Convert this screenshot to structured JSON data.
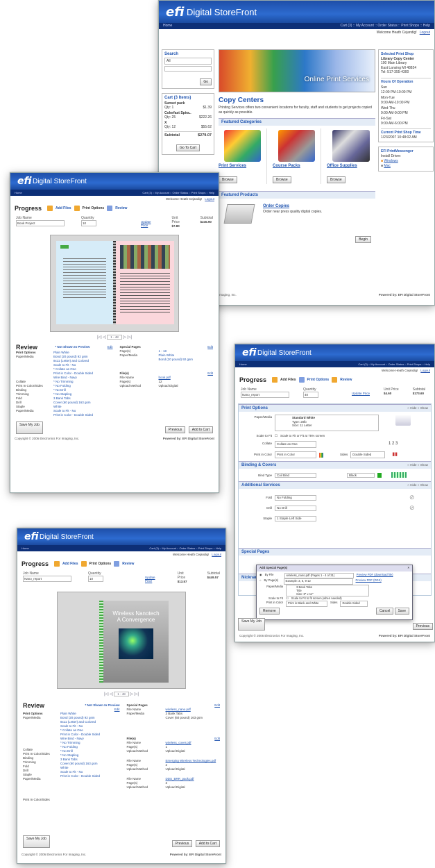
{
  "brand": {
    "logo": "efi",
    "name": "Digital StoreFront"
  },
  "nav": {
    "home": "Home",
    "links": "Cart (3) :: My Account :: Order Status :: Print Shops :: Help"
  },
  "welcome": {
    "text": "Welcome Heath Cejandig!",
    "logout": "Logout"
  },
  "store": {
    "search": {
      "title": "Search",
      "scope": "All",
      "go": "Go"
    },
    "cart": {
      "title": "Cart (3 Items)",
      "items": [
        {
          "name": "Sunset pack",
          "qty": "Qty: 1",
          "price": "$1.39"
        },
        {
          "name": "Colorfast Spira..",
          "qty": "Qty: 25",
          "price": "$222.26"
        },
        {
          "name": "X",
          "qty": "Qty: 12",
          "price": "$55.62"
        }
      ],
      "subtotal_label": "Subtotal",
      "subtotal": "$279.07",
      "go_to_cart": "Go To Cart"
    },
    "banner": "Online Print Services",
    "heading": "Copy Centers",
    "intro": "Printing Services offers two convenient locations for faculty, staff and students to get projects copied as quickly as possible.",
    "featured_categories": "Featured Categories",
    "categories": [
      {
        "name": "Print Services",
        "browse": "Browse"
      },
      {
        "name": "Course Packs",
        "browse": "Browse"
      },
      {
        "name": "Office Supplies",
        "browse": "Browse"
      }
    ],
    "featured_products": "Featured Products",
    "product": {
      "name": "Order Copies",
      "desc": "Order near press quality digital copies.",
      "begin": "Begin"
    },
    "shop": {
      "title": "Selected Print Shop",
      "name": "Library Copy Center",
      "addr1": "100 Main Library",
      "addr2": "East Lansing MI 48824",
      "tel": "Tel: 517-355-4300"
    },
    "hours": {
      "title": "Hours Of Operation",
      "rows": [
        {
          "day": "Sun",
          "time": "12:00 PM-10:00 PM"
        },
        {
          "day": "Mon-Tue",
          "time": "9:00 AM-10:00 PM"
        },
        {
          "day": "Wed-Thu",
          "time": "9:00 AM-9:00 PM"
        },
        {
          "day": "Fri-Sat",
          "time": "9:00 AM-6:00 PM"
        }
      ]
    },
    "current_time": {
      "title": "Current Print Shop Time",
      "value": "1/23/2007 10:48:02 AM"
    },
    "messenger": {
      "title": "EFI PrintMessenger",
      "install": "Install Driver:",
      "windows": "Windows",
      "mac": "Mac"
    },
    "footer_left": "Imaging, Inc.",
    "footer_right": "Powered by: EFI Digital StoreFront"
  },
  "progress": {
    "title": "Progress",
    "add_files": "Add Files",
    "print_options": "Print Options",
    "review": "Review"
  },
  "job": {
    "name_label": "Job Name",
    "name": "Book Project",
    "qty_label": "Quantity",
    "qty": "10",
    "update_price": "Update Price",
    "unit_label": "Unit Price",
    "unit": "$7.80",
    "subtotal_label": "Subtotal",
    "subtotal": "$245.90"
  },
  "job3": {
    "name": "Nano_report",
    "qty": "10",
    "unit": "$13.57",
    "subtotal": "$449.57"
  },
  "job4": {
    "name": "Nano_report",
    "qty": "40",
    "unit": "$4.60",
    "subtotal": "$173.60"
  },
  "review": {
    "title": "Review",
    "not_shown": "* Not Shown In Preview",
    "edit": "Edit",
    "print_options": "Print Options",
    "paper_media": "Paper/Media",
    "special_pages": "Special Pages",
    "file_name": "File Name",
    "pages": "Page(s)",
    "upload_method": "Upload Method",
    "upload_digital": "Upload Digital",
    "files": "File(s)",
    "save": "Save My Job",
    "previous": "Previous",
    "add_to_cart": "Add to Cart"
  },
  "review_values": [
    "Plain White",
    "Bond (20 pound) 92 gsm",
    "8x11 (Letter) and Colored",
    "Scale to Fit - No",
    "* Collate as One",
    "Print in Color - Double Sided",
    "Wire Bind - Navy",
    "* No Trimming",
    "* No Folding",
    "* No Drill",
    "* No Stapling",
    "3 Bank Tabs",
    "Cover (60 pound) 163 gsm",
    "White",
    "Scale to Fit - No",
    "Print in Color - Double Sided"
  ],
  "review_labels": [
    "Collate",
    "Print In Color/Sides",
    "Binding",
    "Trimming",
    "Fold",
    "Drill",
    "Staple",
    "Paper/Media",
    "Print In Color/Sides"
  ],
  "pager": "1 - 48",
  "copyright": "Copyright © 2006 Electronics For Imaging, Inc.",
  "powered": "Powered by: EFI Digital StoreFront",
  "cover_title": "Wireless Nanotech",
  "cover_sub": "A Convergence",
  "options": {
    "print_options": "Print Options",
    "paper_media": "Paper/Media",
    "paper_values": [
      "Standard White",
      "Type: 20lb",
      "Size: 11 Letter"
    ],
    "scale_to_fit": "Scale to Fit",
    "scale_text": "Scale to Fit or Fit at 75% screen",
    "collate": "Collate",
    "collate_val": "Collate as One",
    "print_in_color": "Print in Color",
    "print_val": "Print in Color",
    "sides": "Sides",
    "sides_val": "Double Sided",
    "binding": "Binding & Covers",
    "bind_type": "Bind Type",
    "bind_val": "Coil Bind",
    "bind_color": "Black",
    "additional": "Additional Services",
    "fold": "Fold",
    "fold_val": "No Folding",
    "drill": "Drill",
    "drill_val": "No Drill",
    "staple": "Staple",
    "staple_val": "1 Staple Left Side",
    "special": "Special Pages",
    "nickname": "Nickname",
    "hide": "Hide",
    "show": "Show",
    "dialog": {
      "title": "Add Special Page(s)",
      "by_file": "By File",
      "file_val": "wireless_nano.pdf (Pages 1 - 4 of 31)",
      "preview_link": "Preview PDF (download file)",
      "by_pages": "By Page(s)",
      "pages_example": "Example: 3, 5, 9-12",
      "preview2": "Preview PDF (DDS)",
      "paper_media": "Paper/Media",
      "paper_vals": [
        "3 Bank Tabs",
        "Title",
        "Size: 8\" x 11\""
      ],
      "scale": "Scale to Fit",
      "scale_text": "Scale to Fit to fit screen (when needed)",
      "print_color": "Print in Color",
      "print_val": "Print in Black and White",
      "sides": "Sides",
      "sides_val": "Double Sided",
      "cancel": "Cancel",
      "save": "Save"
    },
    "remove": "Remove"
  }
}
